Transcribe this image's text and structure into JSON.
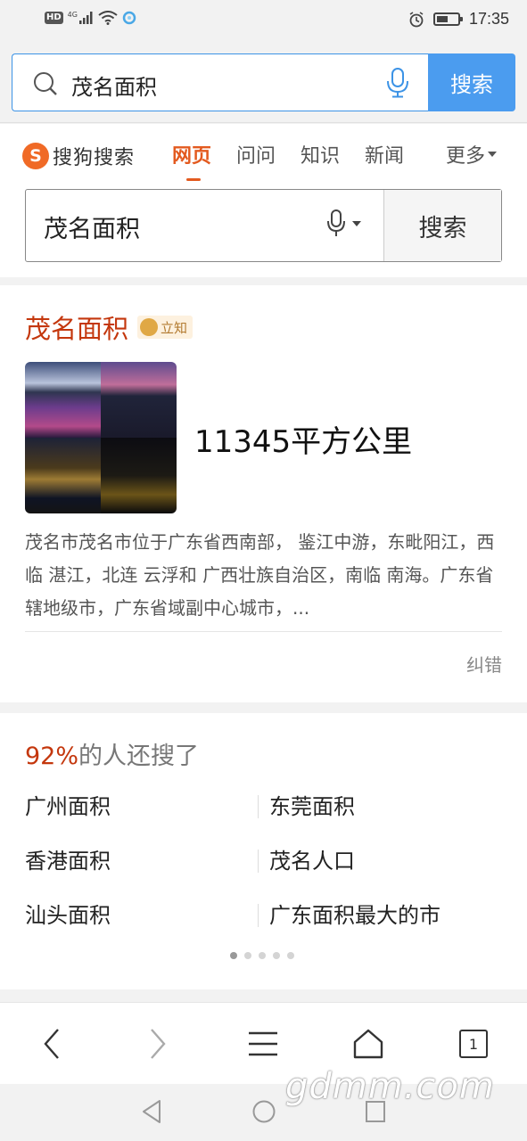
{
  "status_bar": {
    "hd": "HD",
    "network": "4G",
    "time": "17:35",
    "battery_level": 0.55
  },
  "browser": {
    "query": "茂名面积",
    "search_button": "搜索"
  },
  "sogou": {
    "logo_text": "搜狗搜索",
    "nav_tabs": [
      "网页",
      "问问",
      "知识",
      "新闻"
    ],
    "nav_more": "更多",
    "active_tab": "网页",
    "search_query": "茂名面积",
    "search_button": "搜索"
  },
  "result": {
    "title": "茂名面积",
    "badge": "立知",
    "value": "11345平方公里",
    "description": "茂名市茂名市位于广东省西南部， 鉴江中游，东毗阳江，西临 湛江，北连 云浮和 广西壮族自治区，南临 南海。广东省辖地级市，广东省域副中心城市，...",
    "report": "纠错"
  },
  "related": {
    "percent": "92%",
    "header_suffix": "的人还搜了",
    "rows": [
      [
        "广州面积",
        "东莞面积"
      ],
      [
        "香港面积",
        "茂名人口"
      ],
      [
        "汕头面积",
        "广东面积最大的市"
      ]
    ],
    "pages": 5,
    "current_page": 1
  },
  "toolbar": {
    "tab_count": "1"
  },
  "watermark": "gdmm.com",
  "colors": {
    "accent_blue": "#4b9cef",
    "brand_orange": "#e35a1f",
    "title_red": "#c4370d"
  }
}
